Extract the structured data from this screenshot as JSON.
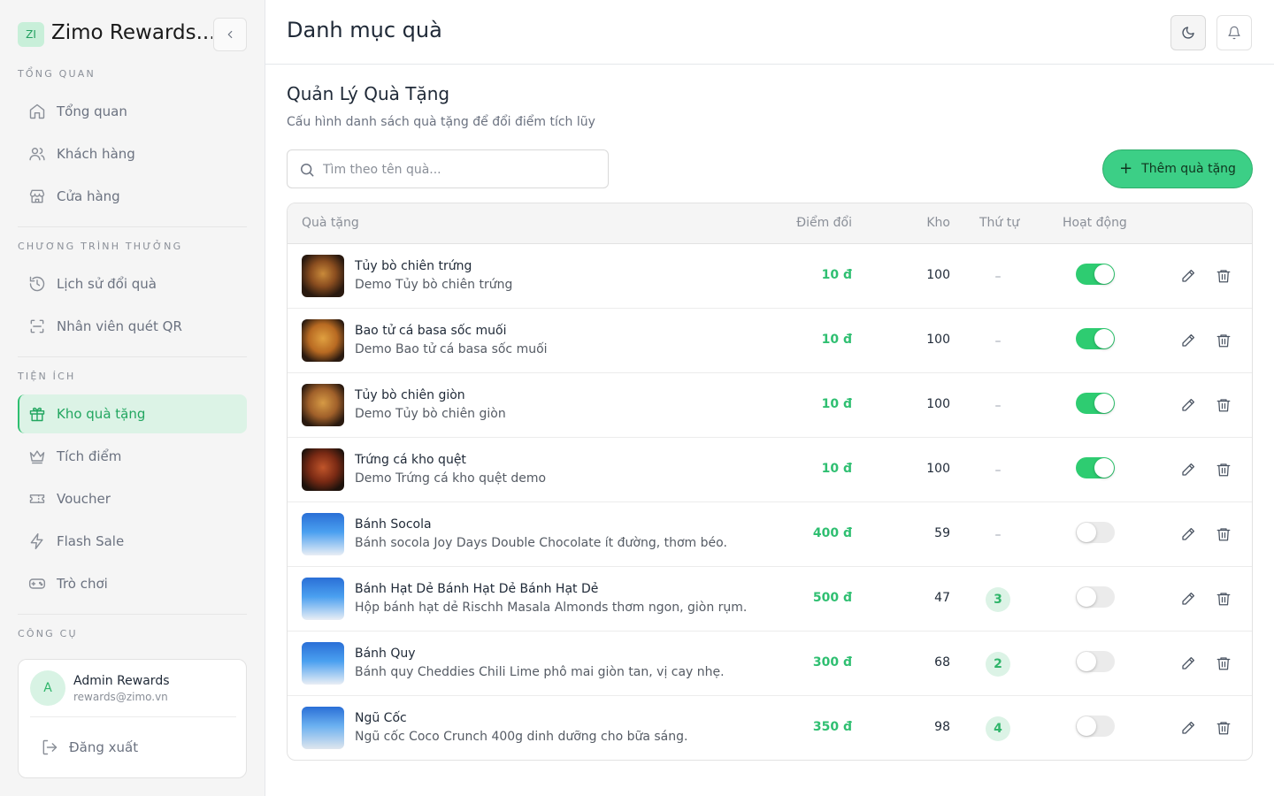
{
  "brand": {
    "logo_text": "ZI",
    "name": "Zimo Rewards..."
  },
  "sidebar": {
    "sections": [
      {
        "label": "TỔNG QUAN"
      },
      {
        "label": "CHƯƠNG TRÌNH THƯỞNG"
      },
      {
        "label": "TIỆN ÍCH"
      },
      {
        "label": "CÔNG CỤ"
      }
    ],
    "items": [
      {
        "label": "Tổng quan",
        "icon": "home-icon"
      },
      {
        "label": "Khách hàng",
        "icon": "users-icon"
      },
      {
        "label": "Cửa hàng",
        "icon": "store-icon"
      },
      {
        "label": "Lịch sử đổi quà",
        "icon": "history-icon"
      },
      {
        "label": "Nhân viên quét QR",
        "icon": "scan-icon"
      },
      {
        "label": "Kho quà tặng",
        "icon": "gift-icon",
        "active": true
      },
      {
        "label": "Tích điểm",
        "icon": "crown-icon"
      },
      {
        "label": "Voucher",
        "icon": "ticket-icon"
      },
      {
        "label": "Flash Sale",
        "icon": "zap-icon"
      },
      {
        "label": "Trò chơi",
        "icon": "gamepad-icon"
      }
    ]
  },
  "user": {
    "avatar": "A",
    "name": "Admin Rewards",
    "email": "rewards@zimo.vn",
    "logout_label": "Đăng xuất"
  },
  "header": {
    "title": "Danh mục quà"
  },
  "main": {
    "heading": "Quản Lý Quà Tặng",
    "subheading": "Cấu hình danh sách quà tặng để đổi điểm tích lũy",
    "search_placeholder": "Tìm theo tên quà...",
    "add_button": "Thêm quà tặng"
  },
  "table": {
    "columns": {
      "gift": "Quà tặng",
      "points": "Điểm đổi",
      "stock": "Kho",
      "order": "Thứ tự",
      "active": "Hoạt động"
    },
    "rows": [
      {
        "name": "Tủy bò chiên trứng",
        "desc": "Demo Tủy bò chiên trứng",
        "points": "10 đ",
        "stock": "100",
        "order": "–",
        "active": true
      },
      {
        "name": "Bao tử cá basa sốc muối",
        "desc": "Demo Bao tử cá basa sốc muối",
        "points": "10 đ",
        "stock": "100",
        "order": "–",
        "active": true
      },
      {
        "name": "Tủy bò chiên giòn",
        "desc": "Demo Tủy bò chiên giòn",
        "points": "10 đ",
        "stock": "100",
        "order": "–",
        "active": true
      },
      {
        "name": "Trứng cá kho quệt",
        "desc": "Demo Trứng cá kho quệt demo",
        "points": "10 đ",
        "stock": "100",
        "order": "–",
        "active": true
      },
      {
        "name": "Bánh Socola",
        "desc": "Bánh socola Joy Days Double Chocolate ít đường, thơm béo.",
        "points": "400 đ",
        "stock": "59",
        "order": "–",
        "active": false
      },
      {
        "name": "Bánh Hạt Dẻ Bánh Hạt Dẻ Bánh Hạt Dẻ",
        "desc": "Hộp bánh hạt dẻ Rischh Masala Almonds thơm ngon, giòn rụm.",
        "points": "500 đ",
        "stock": "47",
        "order": "3",
        "active": false
      },
      {
        "name": "Bánh Quy",
        "desc": "Bánh quy Cheddies Chili Lime phô mai giòn tan, vị cay nhẹ.",
        "points": "300 đ",
        "stock": "68",
        "order": "2",
        "active": false
      },
      {
        "name": "Ngũ Cốc",
        "desc": "Ngũ cốc Coco Crunch 400g dinh dưỡng cho bữa sáng.",
        "points": "350 đ",
        "stock": "98",
        "order": "4",
        "active": false
      }
    ]
  },
  "colors": {
    "accent": "#2fbf71",
    "accent_bg": "#dcf3e6",
    "button": "#3ccf86"
  }
}
